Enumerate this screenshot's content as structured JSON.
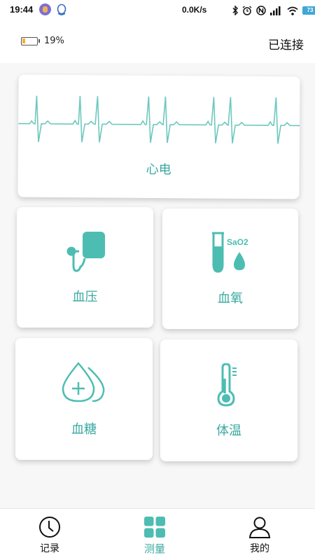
{
  "status_bar": {
    "time": "19:44",
    "net_speed": "0.0K/s",
    "battery_level": "73",
    "icons": [
      "app-avatar-icon",
      "qq-icon",
      "bluetooth-icon",
      "alarm-icon",
      "nfc-icon",
      "signal-icon",
      "wifi-icon",
      "battery-icon"
    ]
  },
  "header": {
    "device_battery_percent": "19%",
    "device_battery_level": 0.19,
    "connection_status": "已连接"
  },
  "cards": {
    "ecg": {
      "label": "心电",
      "icon": "ecg-wave-icon"
    },
    "blood_pressure": {
      "label": "血压",
      "icon": "blood-pressure-cuff-icon"
    },
    "blood_oxygen": {
      "label": "血氧",
      "icon_text": "SaO2",
      "icon": "test-tube-drop-icon"
    },
    "blood_glucose": {
      "label": "血糖",
      "icon": "glucose-drops-icon"
    },
    "temperature": {
      "label": "体温",
      "icon": "thermometer-icon"
    }
  },
  "bottom_nav": {
    "items": [
      {
        "label": "记录",
        "icon": "clock-icon",
        "active": false
      },
      {
        "label": "测量",
        "icon": "grid-icon",
        "active": true
      },
      {
        "label": "我的",
        "icon": "user-icon",
        "active": false
      }
    ]
  },
  "colors": {
    "accent": "#3aa9a0",
    "icon_teal": "#4dbdb2",
    "battery_fill": "#f2b233",
    "background": "#f7f7f7"
  }
}
